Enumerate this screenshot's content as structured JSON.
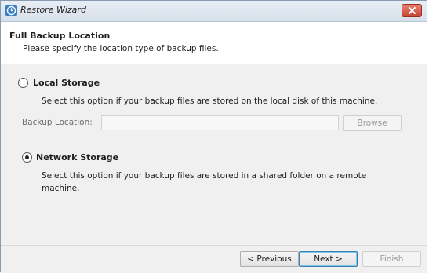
{
  "window": {
    "title": "Restore Wizard"
  },
  "header": {
    "title": "Full Backup Location",
    "subtitle": "Please specify the location type of backup files."
  },
  "local_storage": {
    "label": "Local Storage",
    "selected": false,
    "description": "Select this option if your backup files are stored on the local disk of this machine.",
    "backup_location_label": "Backup Location:",
    "backup_location_value": "",
    "browse_label": "Browse"
  },
  "network_storage": {
    "label": "Network Storage",
    "selected": true,
    "description_line1": "Select this option if your backup files are stored in a shared folder on a remote",
    "description_line2": "machine."
  },
  "footer": {
    "previous_label": "< Previous",
    "next_label": "Next >",
    "finish_label": "Finish"
  },
  "icons": {
    "app": "restore-clock-icon",
    "close": "close-icon"
  }
}
